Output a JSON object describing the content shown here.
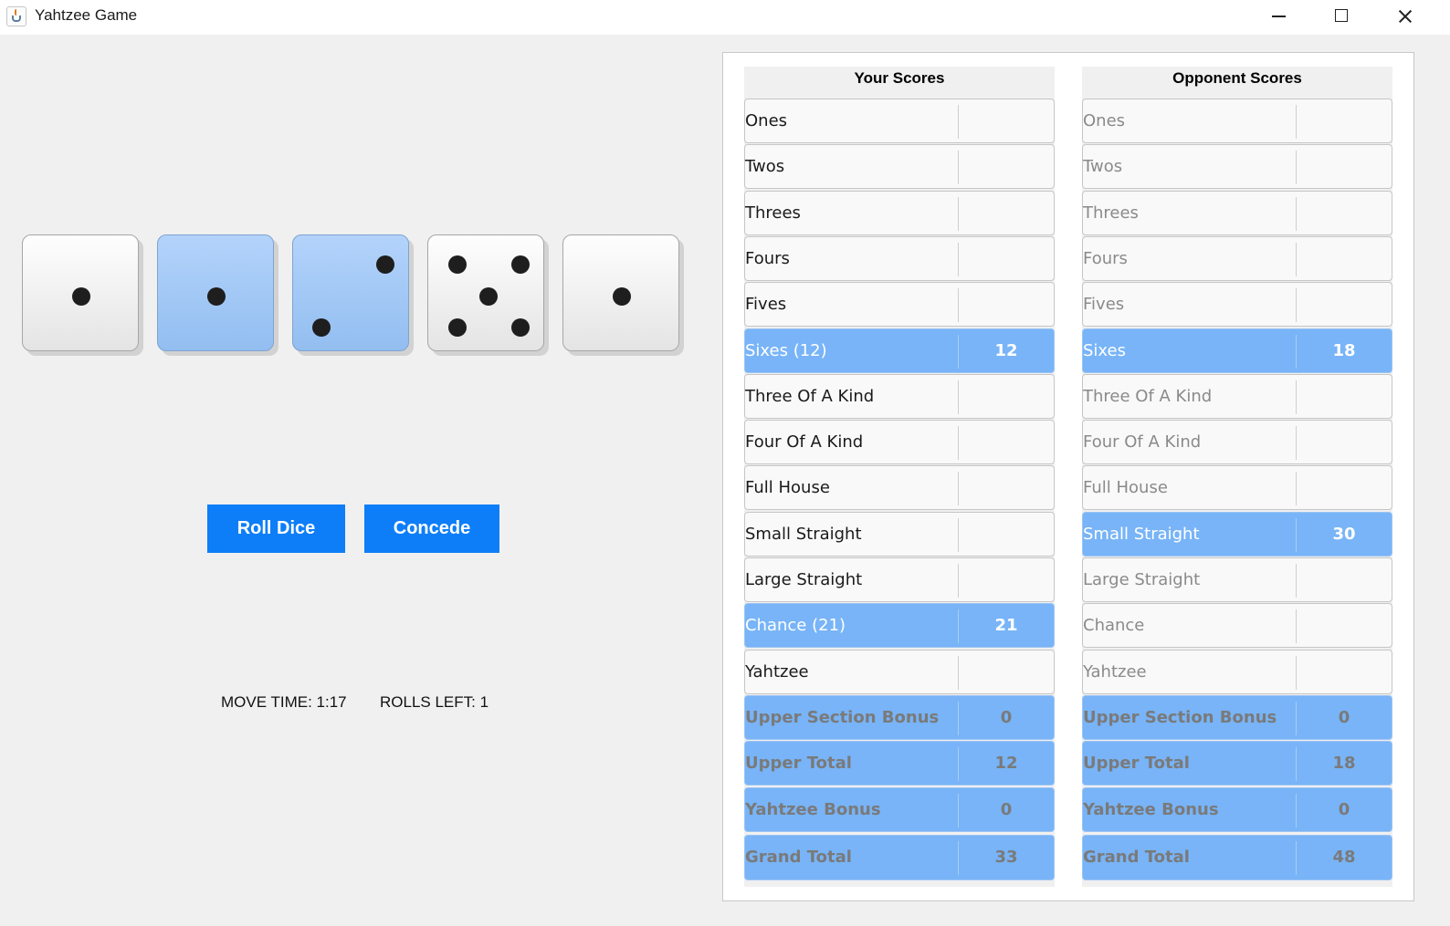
{
  "window": {
    "title": "Yahtzee Game"
  },
  "dice": [
    {
      "value": 1,
      "held": false
    },
    {
      "value": 1,
      "held": true
    },
    {
      "value": 2,
      "held": true
    },
    {
      "value": 5,
      "held": false
    },
    {
      "value": 1,
      "held": false
    }
  ],
  "buttons": {
    "roll": "Roll Dice",
    "concede": "Concede"
  },
  "status": {
    "move_time": "MOVE TIME: 1:17",
    "rolls_left": "ROLLS LEFT: 1"
  },
  "colors": {
    "accent": "#0d7ef8",
    "highlight": "#78b4f7",
    "held_die": "#a4c9f6"
  },
  "your_scores": {
    "heading": "Your Scores",
    "rows": [
      {
        "label": "Ones",
        "value": "",
        "state": "normal"
      },
      {
        "label": "Twos",
        "value": "",
        "state": "normal"
      },
      {
        "label": "Threes",
        "value": "",
        "state": "normal"
      },
      {
        "label": "Fours",
        "value": "",
        "state": "normal"
      },
      {
        "label": "Fives",
        "value": "",
        "state": "normal"
      },
      {
        "label": "Sixes (12)",
        "value": "12",
        "state": "selected"
      },
      {
        "label": "Three Of A Kind",
        "value": "",
        "state": "normal"
      },
      {
        "label": "Four Of A Kind",
        "value": "",
        "state": "normal"
      },
      {
        "label": "Full House",
        "value": "",
        "state": "normal"
      },
      {
        "label": "Small Straight",
        "value": "",
        "state": "normal"
      },
      {
        "label": "Large Straight",
        "value": "",
        "state": "normal"
      },
      {
        "label": "Chance (21)",
        "value": "21",
        "state": "selected"
      },
      {
        "label": "Yahtzee",
        "value": "",
        "state": "normal"
      },
      {
        "label": "Upper Section Bonus",
        "value": "0",
        "state": "total"
      },
      {
        "label": "Upper Total",
        "value": "12",
        "state": "total"
      },
      {
        "label": "Yahtzee Bonus",
        "value": "0",
        "state": "total"
      },
      {
        "label": "Grand Total",
        "value": "33",
        "state": "total"
      }
    ]
  },
  "opponent_scores": {
    "heading": "Opponent Scores",
    "rows": [
      {
        "label": "Ones",
        "value": "",
        "state": "normal"
      },
      {
        "label": "Twos",
        "value": "",
        "state": "normal"
      },
      {
        "label": "Threes",
        "value": "",
        "state": "normal"
      },
      {
        "label": "Fours",
        "value": "",
        "state": "normal"
      },
      {
        "label": "Fives",
        "value": "",
        "state": "normal"
      },
      {
        "label": "Sixes",
        "value": "18",
        "state": "selected"
      },
      {
        "label": "Three Of A Kind",
        "value": "",
        "state": "normal"
      },
      {
        "label": "Four Of A Kind",
        "value": "",
        "state": "normal"
      },
      {
        "label": "Full House",
        "value": "",
        "state": "normal"
      },
      {
        "label": "Small Straight",
        "value": "30",
        "state": "selected"
      },
      {
        "label": "Large Straight",
        "value": "",
        "state": "normal"
      },
      {
        "label": "Chance",
        "value": "",
        "state": "normal"
      },
      {
        "label": "Yahtzee",
        "value": "",
        "state": "normal"
      },
      {
        "label": "Upper Section Bonus",
        "value": "0",
        "state": "total"
      },
      {
        "label": "Upper Total",
        "value": "18",
        "state": "total"
      },
      {
        "label": "Yahtzee Bonus",
        "value": "0",
        "state": "total"
      },
      {
        "label": "Grand Total",
        "value": "48",
        "state": "total"
      }
    ]
  }
}
